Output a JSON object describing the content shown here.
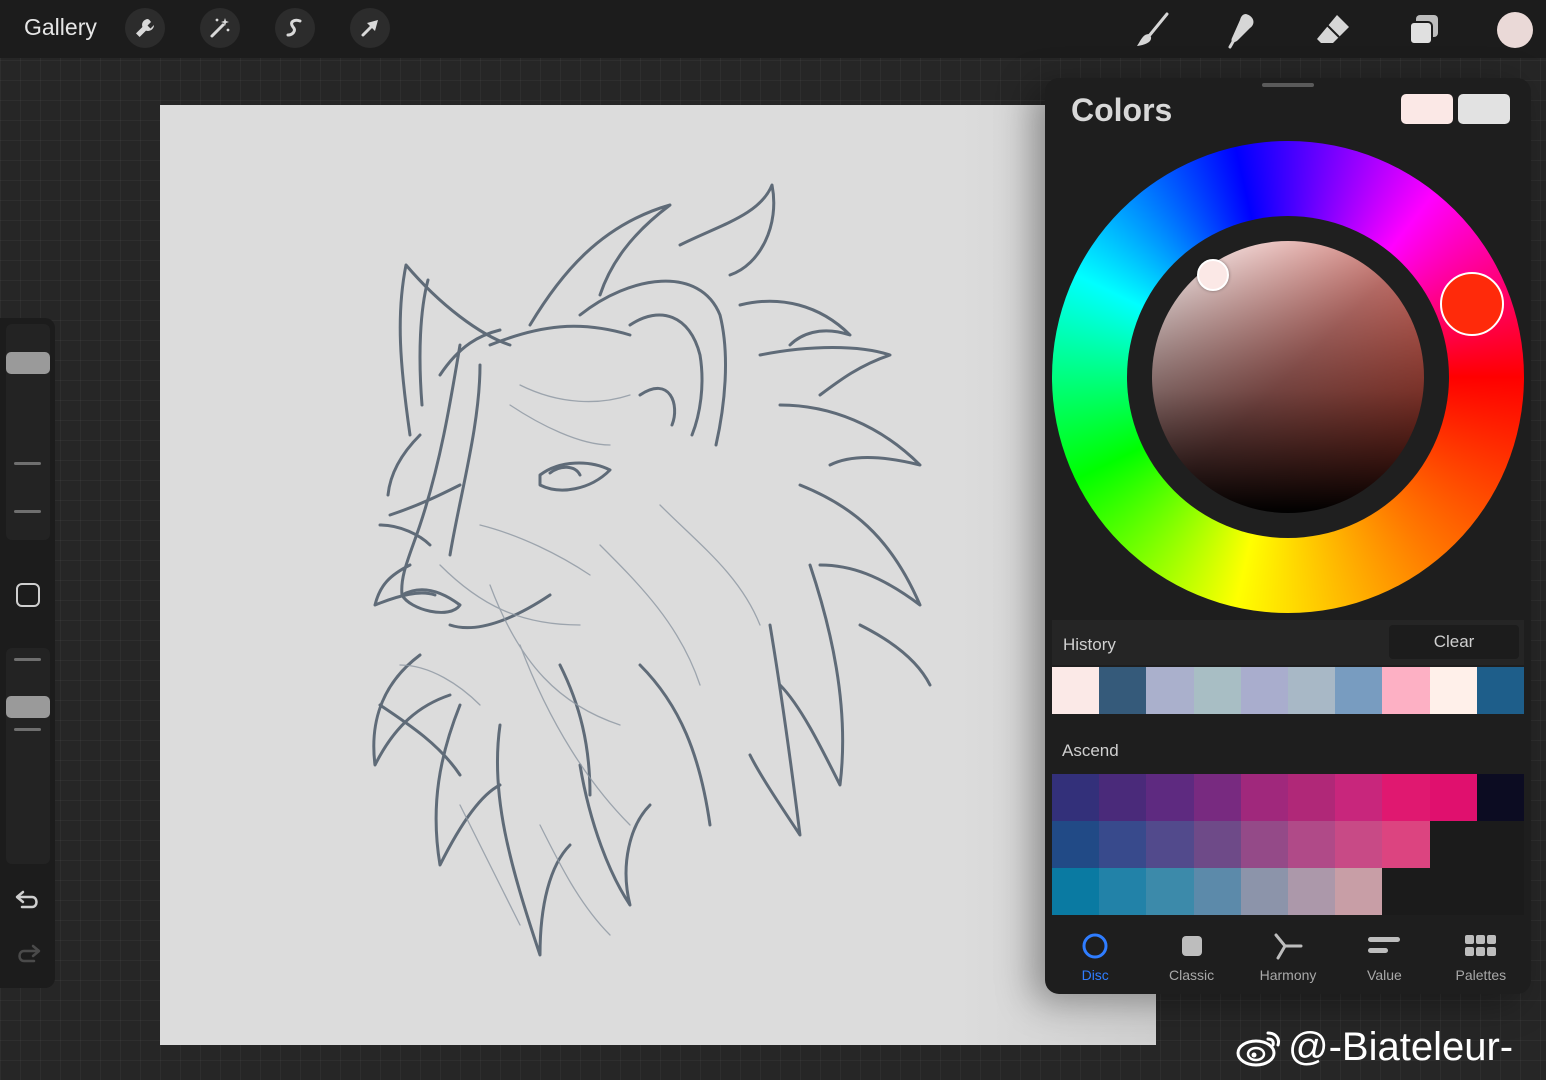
{
  "topbar": {
    "gallery_label": "Gallery",
    "left_tools": [
      "wrench-icon",
      "magic-wand-icon",
      "selection-icon",
      "transform-arrow-icon"
    ],
    "right_tools": [
      "brush-icon",
      "smudge-icon",
      "eraser-icon",
      "layers-icon"
    ],
    "current_color": "#ead9d7"
  },
  "sidebar": {
    "brush_size_icon": "slider",
    "opacity_icon": "slider",
    "modify_button": "square-icon",
    "undo_icon": "undo-icon",
    "redo_icon": "redo-icon"
  },
  "panel": {
    "title": "Colors",
    "primary_color": "#fbe8e6",
    "secondary_color": "#e2e2e2",
    "hue_color": "#ff2a0a",
    "history": {
      "label": "History",
      "clear_label": "Clear",
      "colors": [
        "#fbe9e7",
        "#355a7a",
        "#aab0cc",
        "#a8bec4",
        "#a9adcd",
        "#a8b8c6",
        "#789cc0",
        "#fdb0c4",
        "#fff0ea",
        "#1e5e8a"
      ]
    },
    "palette": {
      "name": "Ascend",
      "rows": [
        [
          "#33307a",
          "#4a2a7a",
          "#5e2a80",
          "#782a80",
          "#a0287c",
          "#b02878",
          "#c8267c",
          "#e01870",
          "#e0106e",
          "#0c0c22"
        ],
        [
          "#214a86",
          "#384a8c",
          "#524a8c",
          "#6e4a88",
          "#944a88",
          "#b04a88",
          "#c84a86",
          "#dc4480",
          "#1b1b1b",
          "#1b1b1b"
        ],
        [
          "#0a7aa2",
          "#2282a8",
          "#3c8aaa",
          "#5c8aaa",
          "#8c94aa",
          "#ac98aa",
          "#c89ea6",
          "#1b1b1b",
          "#1b1b1b",
          "#1b1b1b"
        ]
      ]
    },
    "tabs": [
      {
        "label": "Disc",
        "icon": "disc-icon",
        "active": true
      },
      {
        "label": "Classic",
        "icon": "classic-square-icon",
        "active": false
      },
      {
        "label": "Harmony",
        "icon": "harmony-icon",
        "active": false
      },
      {
        "label": "Value",
        "icon": "value-sliders-icon",
        "active": false
      },
      {
        "label": "Palettes",
        "icon": "palettes-grid-icon",
        "active": false
      }
    ]
  },
  "watermark": {
    "icon": "weibo-icon",
    "text": "@-Biateleur-"
  }
}
